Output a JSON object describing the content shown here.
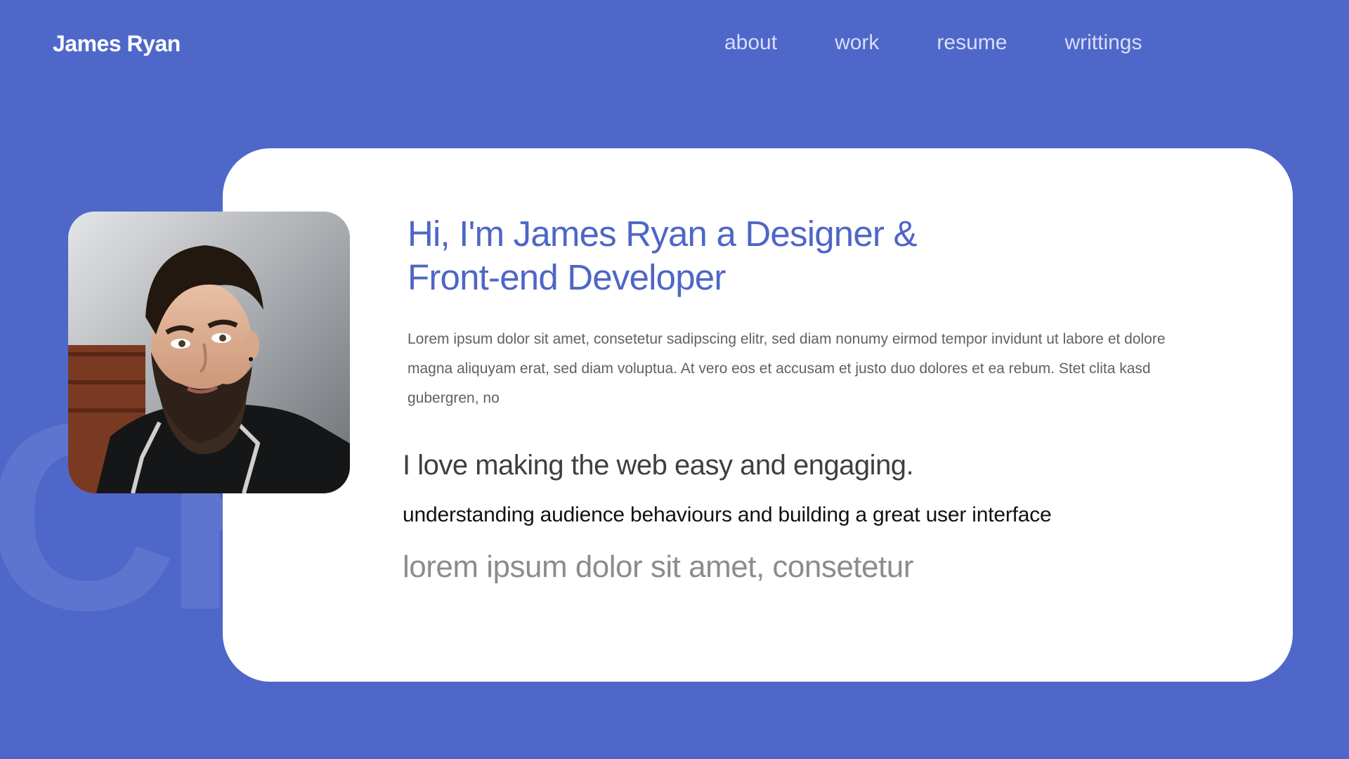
{
  "header": {
    "brand": "James Ryan",
    "nav": [
      {
        "label": "about"
      },
      {
        "label": "work"
      },
      {
        "label": "resume"
      },
      {
        "label": "writtings"
      }
    ]
  },
  "hero": {
    "title_line1": "Hi, I'm James Ryan  a Designer &",
    "title_line2": "Front-end Developer",
    "intro": "Lorem ipsum dolor sit amet, consetetur sadipscing elitr, sed diam nonumy eirmod tempor invidunt ut labore et dolore magna aliquyam erat, sed diam voluptua. At vero eos et accusam et justo duo dolores et ea rebum. Stet clita kasd gubergren, no",
    "tagline": "I love making the web easy and engaging.",
    "subline": "understanding audience behaviours and building a great user interface",
    "lorem_big": "lorem ipsum dolor sit amet, consetetur",
    "photo_icon": "portrait-photo",
    "background_letters": "CH"
  },
  "colors": {
    "background": "#4f67c9",
    "card": "#ffffff",
    "title": "#4e66c7",
    "nav": "#d7defa"
  }
}
